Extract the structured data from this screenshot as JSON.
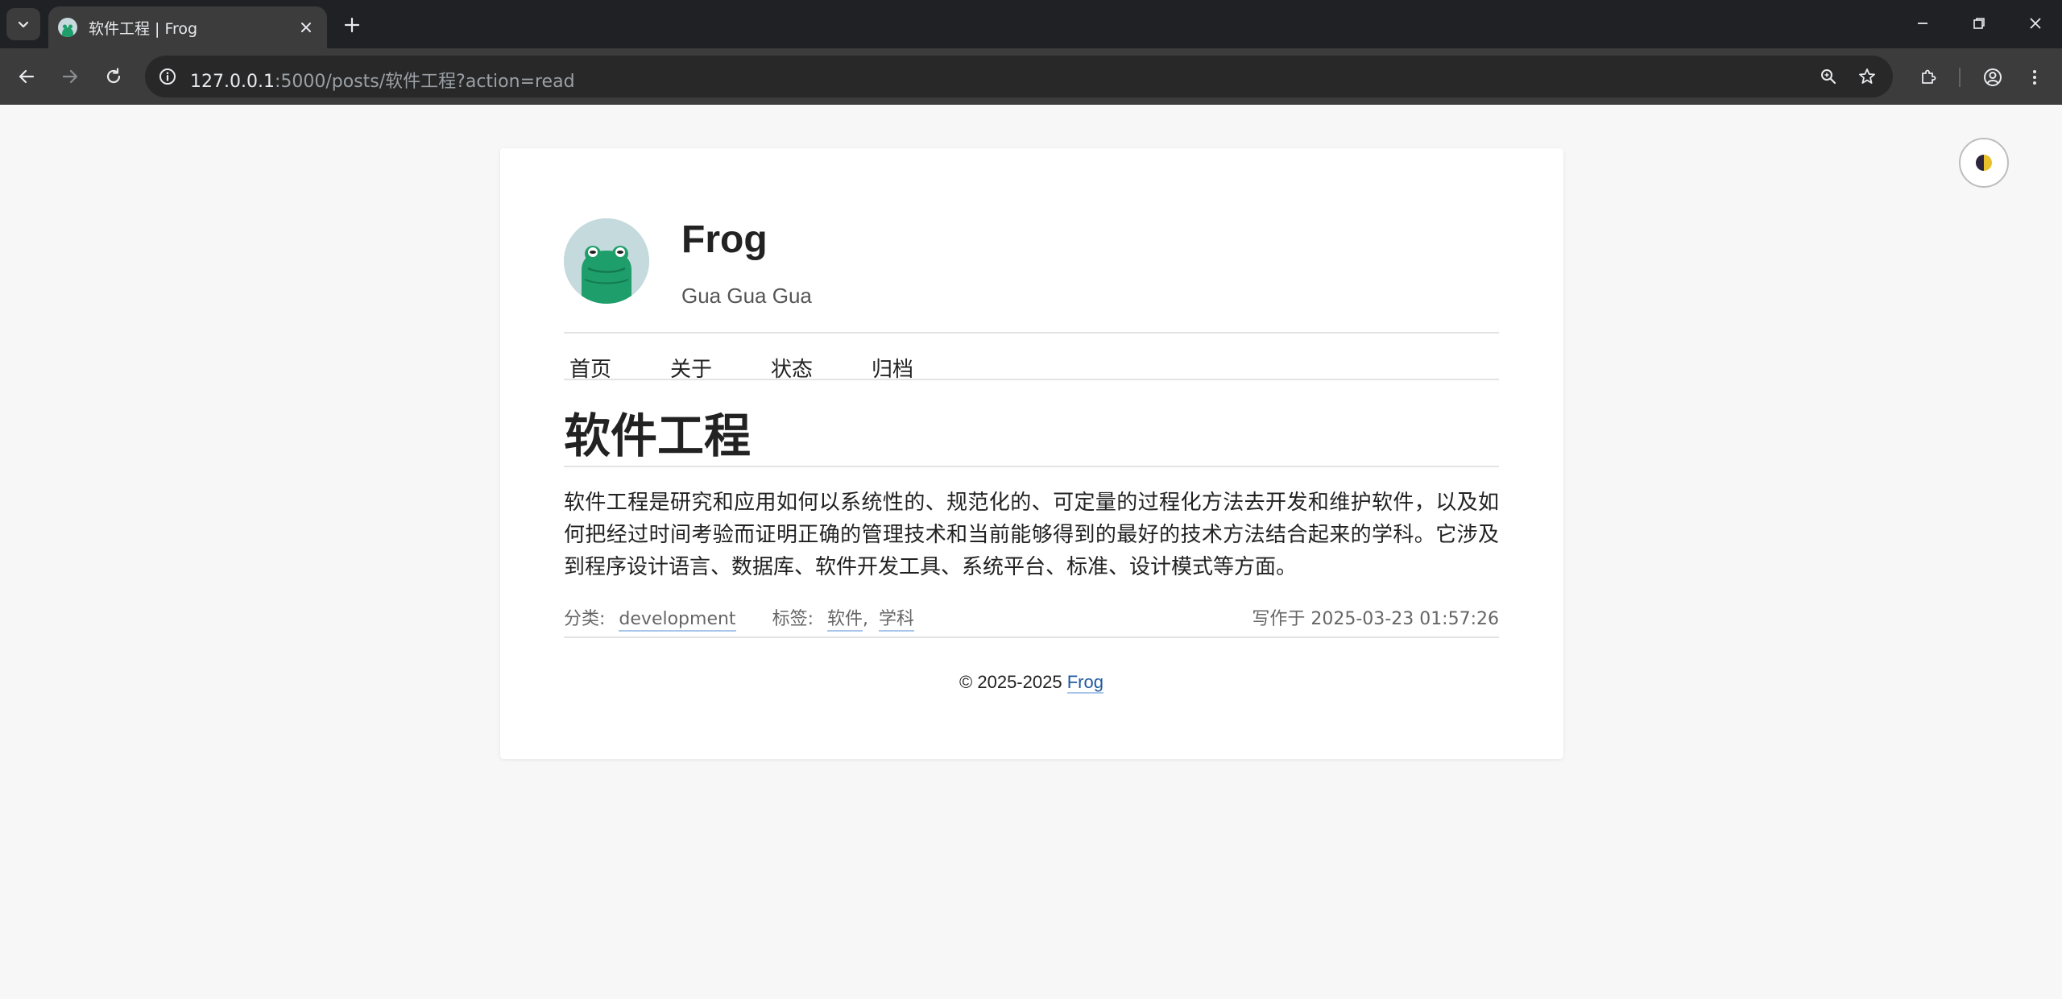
{
  "browser": {
    "tab_title": "软件工程 | Frog",
    "url_host": "127.0.0.1",
    "url_rest": ":5000/posts/软件工程?action=read"
  },
  "site": {
    "title": "Frog",
    "description": "Gua Gua Gua",
    "nav": [
      "首页",
      "关于",
      "状态",
      "归档"
    ]
  },
  "post": {
    "title": "软件工程",
    "body": "软件工程是研究和应用如何以系统性的、规范化的、可定量的过程化方法去开发和维护软件，以及如何把经过时间考验而证明正确的管理技术和当前能够得到的最好的技术方法结合起来的学科。它涉及到程序设计语言、数据库、软件开发工具、系统平台、标准、设计模式等方面。",
    "category_label": "分类:",
    "category": "development",
    "tags_label": "标签:",
    "tags": [
      "软件",
      "学科"
    ],
    "tag_separator": ",",
    "written_label": "写作于",
    "written_at": "2025-03-23 01:57:26"
  },
  "footer": {
    "copyright": "© 2025-2025",
    "author_link": "Frog"
  },
  "colors": {
    "frog_green": "#1e9e6a",
    "link_blue": "#1e5aa0"
  }
}
